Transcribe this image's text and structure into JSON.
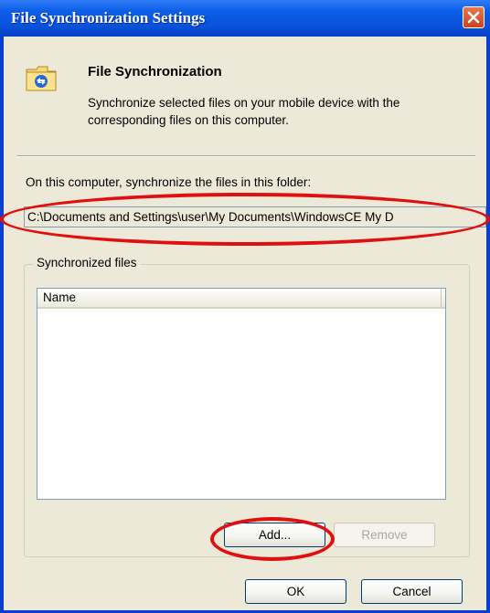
{
  "window": {
    "title": "File Synchronization Settings"
  },
  "header": {
    "title": "File Synchronization",
    "description": "Synchronize selected files on your mobile device with the corresponding files on this computer.",
    "icon": "sync-folder-icon"
  },
  "folder": {
    "label": "On this computer, synchronize the files in this folder:",
    "path": "C:\\Documents and Settings\\user\\My Documents\\WindowsCE My D"
  },
  "synced_files": {
    "group_label": "Synchronized files",
    "columns": [
      "Name"
    ],
    "rows": []
  },
  "buttons": {
    "add": "Add...",
    "remove": "Remove",
    "ok": "OK",
    "cancel": "Cancel"
  },
  "annotations": {
    "highlight_color": "#e01010"
  },
  "colors": {
    "titlebar": "#0a52dc",
    "dialog_bg": "#ece9d8"
  }
}
